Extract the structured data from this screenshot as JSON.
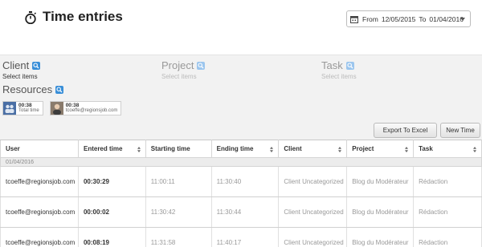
{
  "header": {
    "title": "Time entries",
    "date_range": {
      "from_label": "From",
      "from": "12/05/2015",
      "to_label": "To",
      "to": "01/04/2016"
    }
  },
  "filters": {
    "client": {
      "label": "Client",
      "hint": "Select items"
    },
    "project": {
      "label": "Project",
      "hint": "Select items"
    },
    "task": {
      "label": "Task",
      "hint": "Select items"
    },
    "resources": {
      "label": "Resources"
    }
  },
  "resource_cards": [
    {
      "time": "00:38",
      "name": "Total time"
    },
    {
      "time": "00:38",
      "name": "tcoeffe@regionsjob.com"
    }
  ],
  "toolbar": {
    "export_label": "Export To Excel",
    "new_label": "New Time"
  },
  "table": {
    "columns": [
      "User",
      "Entered time",
      "Starting time",
      "Ending time",
      "Client",
      "Project",
      "Task"
    ],
    "group_label": "01/04/2016",
    "rows": [
      {
        "user": "tcoeffe@regionsjob.com",
        "entered": "00:30:29",
        "start": "11:00:11",
        "end": "11:30:40",
        "client": "Client Uncategorized",
        "project": "Blog du Modérateur",
        "task": "Rédaction"
      },
      {
        "user": "tcoeffe@regionsjob.com",
        "entered": "00:00:02",
        "start": "11:30:42",
        "end": "11:30:44",
        "client": "Client Uncategorized",
        "project": "Blog du Modérateur",
        "task": "Rédaction"
      },
      {
        "user": "tcoeffe@regionsjob.com",
        "entered": "00:08:19",
        "start": "11:31:58",
        "end": "11:40:17",
        "client": "Client Uncategorized",
        "project": "Blog du Modérateur",
        "task": "Rédaction"
      }
    ]
  }
}
